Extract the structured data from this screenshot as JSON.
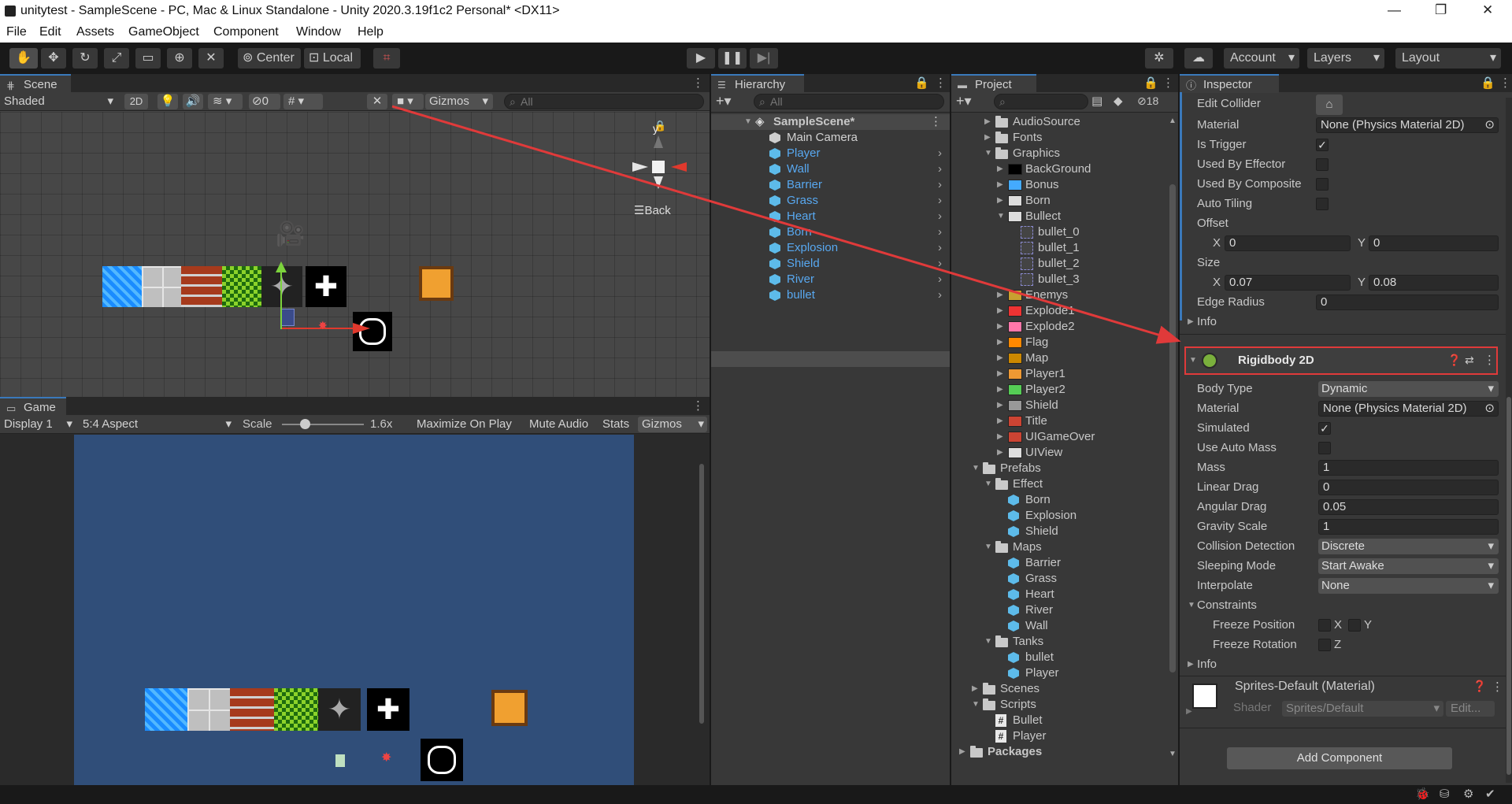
{
  "window": {
    "title": "unitytest - SampleScene - PC, Mac & Linux Standalone - Unity 2020.3.19f1c2 Personal* <DX11>"
  },
  "menu": [
    "File",
    "Edit",
    "Assets",
    "GameObject",
    "Component",
    "Window",
    "Help"
  ],
  "toolbar": {
    "center": "Center",
    "local": "Local",
    "account": "Account",
    "layers": "Layers",
    "layout": "Layout"
  },
  "scene": {
    "tab": "Scene",
    "shading": "Shaded",
    "mode2d": "2D",
    "hidden_count": "0",
    "gizmos": "Gizmos",
    "search_placeholder": "All",
    "axis_x": "x",
    "axis_y": "y",
    "back": "Back"
  },
  "game": {
    "tab": "Game",
    "display": "Display 1",
    "aspect": "5:4 Aspect",
    "scale_label": "Scale",
    "scale_value": "1.6x",
    "maximize": "Maximize On Play",
    "mute": "Mute Audio",
    "stats": "Stats",
    "gizmos": "Gizmos"
  },
  "hierarchy": {
    "tab": "Hierarchy",
    "search_placeholder": "All",
    "scene": "SampleScene*",
    "items": [
      "Main Camera",
      "Player",
      "Wall",
      "Barrier",
      "Grass",
      "Heart",
      "Born",
      "Explosion",
      "Shield",
      "River",
      "bullet"
    ]
  },
  "project": {
    "tab": "Project",
    "hidden_count": "18",
    "items": [
      {
        "label": "AudioSource",
        "type": "folder",
        "depth": 2,
        "arrow": "right"
      },
      {
        "label": "Fonts",
        "type": "folder",
        "depth": 2,
        "arrow": "right"
      },
      {
        "label": "Graphics",
        "type": "folder",
        "depth": 2,
        "arrow": "down"
      },
      {
        "label": "BackGround",
        "type": "sprite",
        "depth": 3,
        "arrow": "right"
      },
      {
        "label": "Bonus",
        "type": "sprite",
        "depth": 3,
        "arrow": "right"
      },
      {
        "label": "Born",
        "type": "sprite",
        "depth": 3,
        "arrow": "right"
      },
      {
        "label": "Bullect",
        "type": "sprite",
        "depth": 3,
        "arrow": "down"
      },
      {
        "label": "bullet_0",
        "type": "subsprite",
        "depth": 4,
        "arrow": ""
      },
      {
        "label": "bullet_1",
        "type": "subsprite",
        "depth": 4,
        "arrow": ""
      },
      {
        "label": "bullet_2",
        "type": "subsprite",
        "depth": 4,
        "arrow": ""
      },
      {
        "label": "bullet_3",
        "type": "subsprite",
        "depth": 4,
        "arrow": ""
      },
      {
        "label": "Enemys",
        "type": "sprite",
        "depth": 3,
        "arrow": "right"
      },
      {
        "label": "Explode1",
        "type": "sprite",
        "depth": 3,
        "arrow": "right"
      },
      {
        "label": "Explode2",
        "type": "sprite",
        "depth": 3,
        "arrow": "right"
      },
      {
        "label": "Flag",
        "type": "sprite",
        "depth": 3,
        "arrow": "right"
      },
      {
        "label": "Map",
        "type": "sprite",
        "depth": 3,
        "arrow": "right"
      },
      {
        "label": "Player1",
        "type": "sprite",
        "depth": 3,
        "arrow": "right"
      },
      {
        "label": "Player2",
        "type": "sprite",
        "depth": 3,
        "arrow": "right"
      },
      {
        "label": "Shield",
        "type": "sprite",
        "depth": 3,
        "arrow": "right"
      },
      {
        "label": "Title",
        "type": "sprite",
        "depth": 3,
        "arrow": "right"
      },
      {
        "label": "UIGameOver",
        "type": "sprite",
        "depth": 3,
        "arrow": "right"
      },
      {
        "label": "UIView",
        "type": "sprite",
        "depth": 3,
        "arrow": "right"
      },
      {
        "label": "Prefabs",
        "type": "folder",
        "depth": 1,
        "arrow": "down"
      },
      {
        "label": "Effect",
        "type": "folder",
        "depth": 2,
        "arrow": "down"
      },
      {
        "label": "Born",
        "type": "prefab",
        "depth": 3,
        "arrow": ""
      },
      {
        "label": "Explosion",
        "type": "prefab",
        "depth": 3,
        "arrow": ""
      },
      {
        "label": "Shield",
        "type": "prefab",
        "depth": 3,
        "arrow": ""
      },
      {
        "label": "Maps",
        "type": "folder",
        "depth": 2,
        "arrow": "down"
      },
      {
        "label": "Barrier",
        "type": "prefab",
        "depth": 3,
        "arrow": ""
      },
      {
        "label": "Grass",
        "type": "prefab",
        "depth": 3,
        "arrow": ""
      },
      {
        "label": "Heart",
        "type": "prefab",
        "depth": 3,
        "arrow": ""
      },
      {
        "label": "River",
        "type": "prefab",
        "depth": 3,
        "arrow": ""
      },
      {
        "label": "Wall",
        "type": "prefab",
        "depth": 3,
        "arrow": ""
      },
      {
        "label": "Tanks",
        "type": "folder",
        "depth": 2,
        "arrow": "down"
      },
      {
        "label": "bullet",
        "type": "prefab",
        "depth": 3,
        "arrow": ""
      },
      {
        "label": "Player",
        "type": "prefab",
        "depth": 3,
        "arrow": ""
      },
      {
        "label": "Scenes",
        "type": "folder",
        "depth": 1,
        "arrow": "right"
      },
      {
        "label": "Scripts",
        "type": "folder",
        "depth": 1,
        "arrow": "down"
      },
      {
        "label": "Bullet",
        "type": "script",
        "depth": 2,
        "arrow": ""
      },
      {
        "label": "Player",
        "type": "script",
        "depth": 2,
        "arrow": ""
      },
      {
        "label": "Packages",
        "type": "folder",
        "depth": 0,
        "arrow": "right",
        "bold": true
      }
    ]
  },
  "inspector": {
    "tab": "Inspector",
    "collider": {
      "edit_collider": "Edit Collider",
      "material_label": "Material",
      "material_value": "None (Physics Material 2D)",
      "is_trigger": "Is Trigger",
      "is_trigger_checked": true,
      "used_by_effector": "Used By Effector",
      "used_by_composite": "Used By Composite",
      "auto_tiling": "Auto Tiling",
      "offset": "Offset",
      "offset_x": "0",
      "offset_y": "0",
      "size": "Size",
      "size_x": "0.07",
      "size_y": "0.08",
      "edge_radius": "Edge Radius",
      "edge_radius_value": "0",
      "info": "Info",
      "x": "X",
      "y": "Y"
    },
    "rigidbody": {
      "title": "Rigidbody 2D",
      "body_type": "Body Type",
      "body_type_value": "Dynamic",
      "material": "Material",
      "material_value": "None (Physics Material 2D)",
      "simulated": "Simulated",
      "simulated_checked": true,
      "use_auto_mass": "Use Auto Mass",
      "mass": "Mass",
      "mass_value": "1",
      "linear_drag": "Linear Drag",
      "linear_drag_value": "0",
      "angular_drag": "Angular Drag",
      "angular_drag_value": "0.05",
      "gravity_scale": "Gravity Scale",
      "gravity_scale_value": "1",
      "collision_detection": "Collision Detection",
      "collision_detection_value": "Discrete",
      "sleeping_mode": "Sleeping Mode",
      "sleeping_mode_value": "Start Awake",
      "interpolate": "Interpolate",
      "interpolate_value": "None",
      "constraints": "Constraints",
      "freeze_position": "Freeze Position",
      "freeze_rotation": "Freeze Rotation",
      "x": "X",
      "y": "Y",
      "z": "Z",
      "info": "Info"
    },
    "material": {
      "name": "Sprites-Default (Material)",
      "shader_label": "Shader",
      "shader_value": "Sprites/Default",
      "edit": "Edit..."
    },
    "add_component": "Add Component"
  },
  "colors": {
    "accent_blue": "#3a79bb",
    "highlight_red": "#e03a3a",
    "game_bg": "#304e79",
    "hierarchy_blue": "#58a8f0"
  }
}
